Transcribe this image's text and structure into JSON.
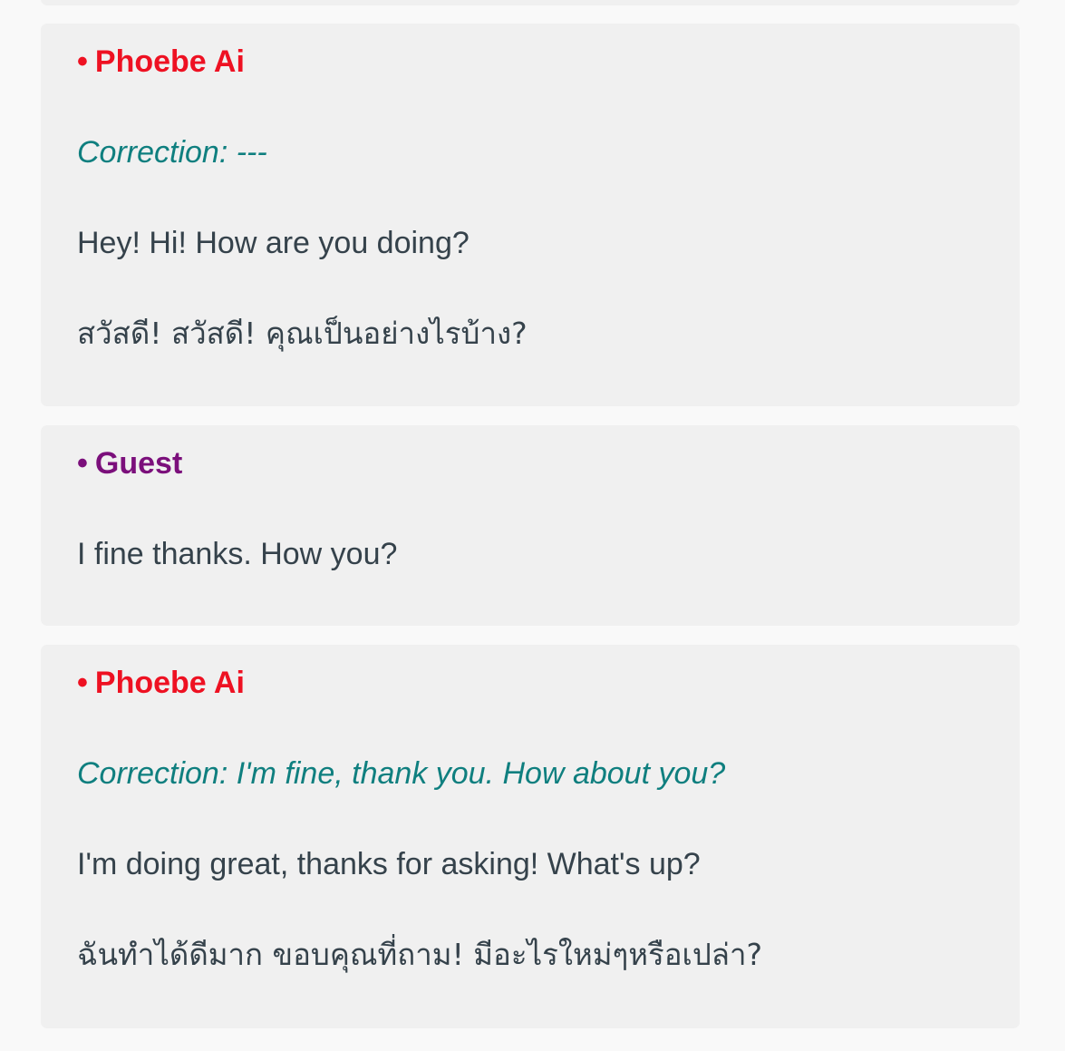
{
  "colors": {
    "page_bg": "#f9f9f9",
    "card_bg": "#f0f0f0",
    "ai_speaker": "#ee1122",
    "guest_speaker": "#7b0f7b",
    "correction": "#0f7f7f",
    "message_text": "#35424b"
  },
  "messages": [
    {
      "speaker_bullet": "•",
      "speaker": "Phoebe Ai",
      "correction": "Correction: ---",
      "text_en": "Hey! Hi! How are you doing?",
      "text_th": "สวัสดี! สวัสดี! คุณเป็นอย่างไรบ้าง?"
    },
    {
      "speaker_bullet": "•",
      "speaker": "Guest",
      "text_en": "I fine thanks. How you?"
    },
    {
      "speaker_bullet": "•",
      "speaker": "Phoebe Ai",
      "correction": "Correction: I'm fine, thank you. How about you?",
      "text_en": "I'm doing great, thanks for asking! What's up?",
      "text_th": "ฉันทำได้ดีมาก ขอบคุณที่ถาม! มีอะไรใหม่ๆหรือเปล่า?"
    }
  ]
}
